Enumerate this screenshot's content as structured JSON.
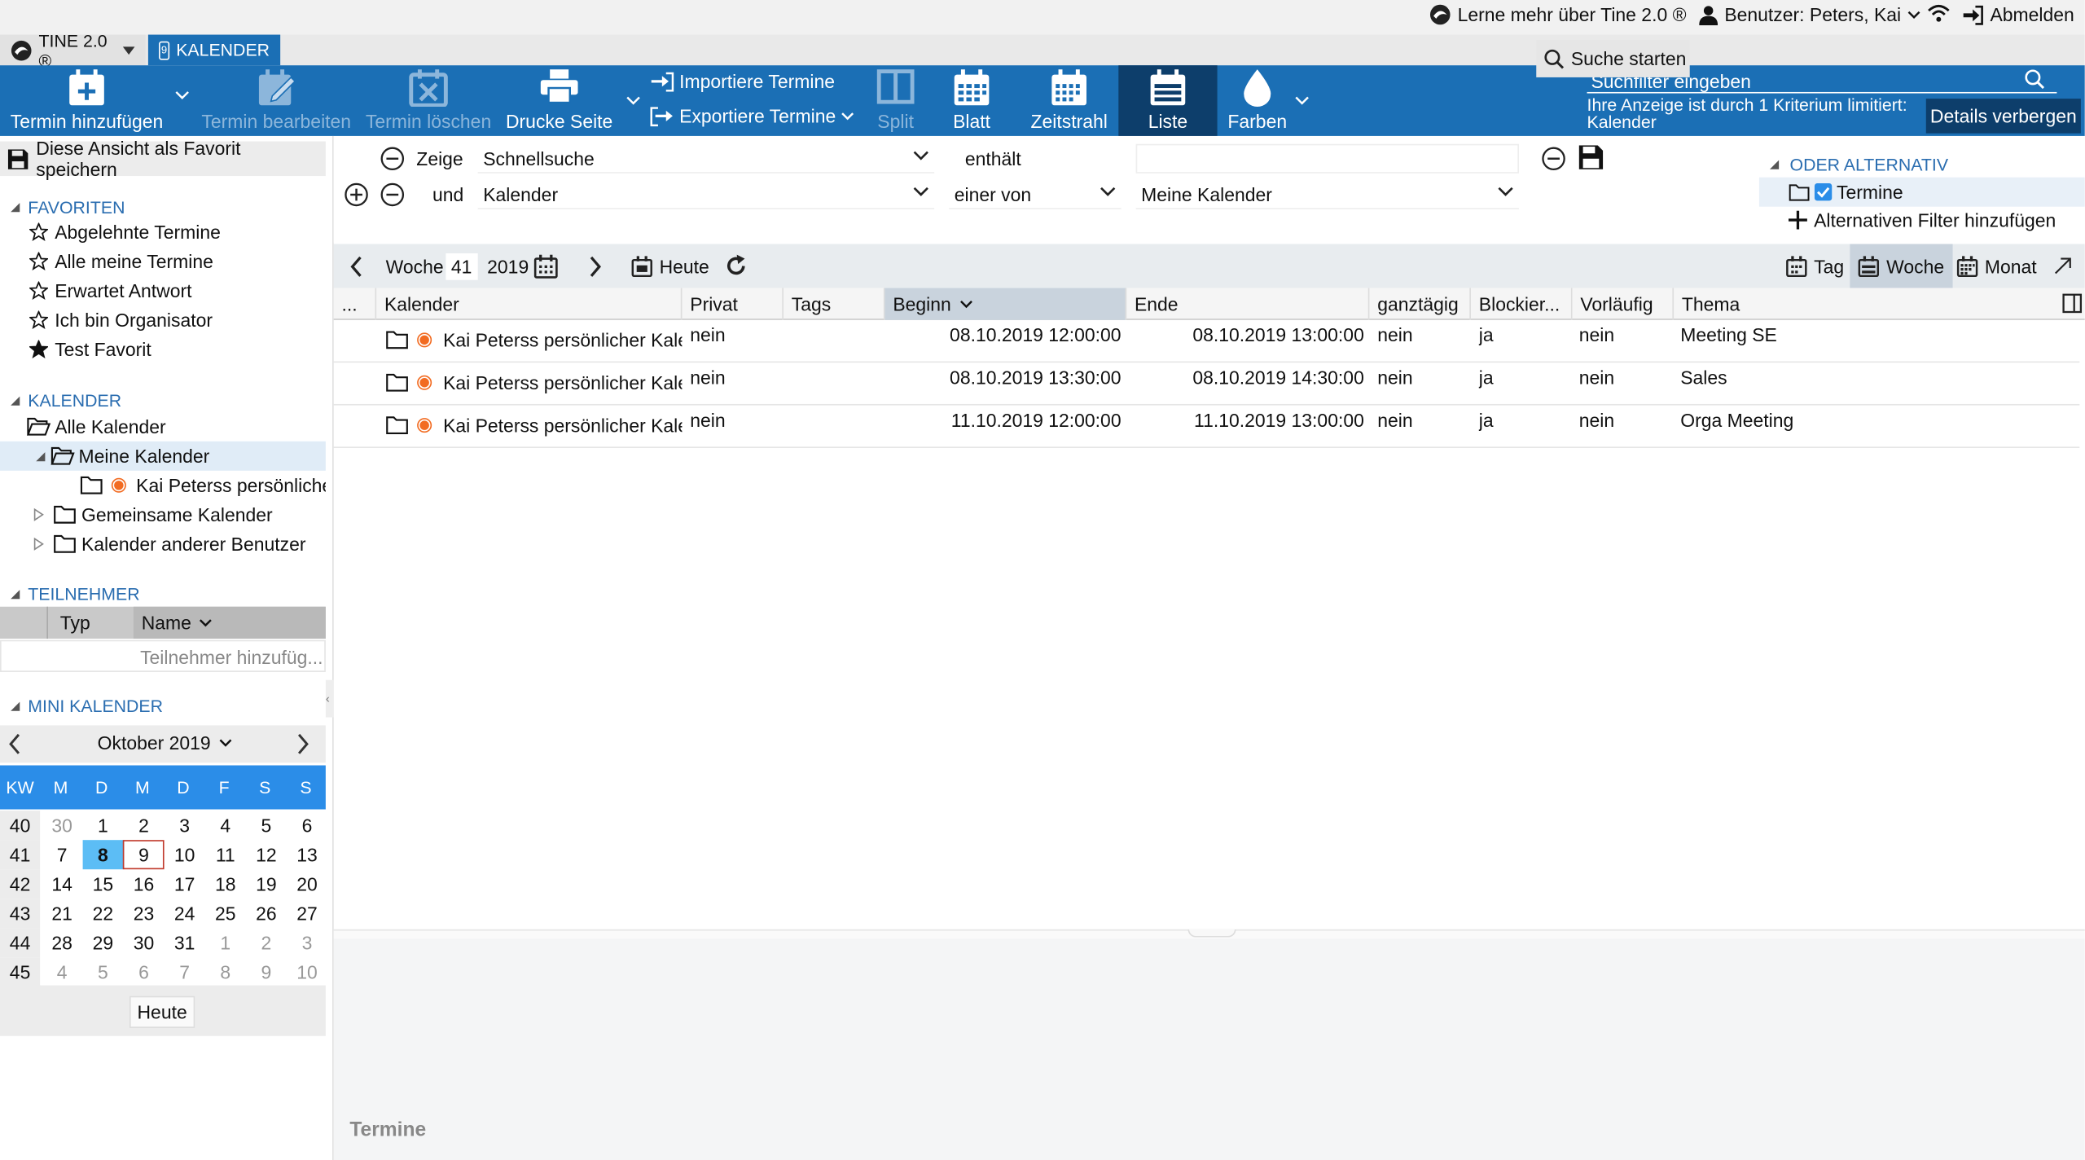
{
  "topbar": {
    "learn_more": "Lerne mehr über Tine 2.0 ®",
    "user": "Benutzer: Peters, Kai",
    "logout": "Abmelden"
  },
  "tabs": {
    "app": "TINE 2.0 ®",
    "calendar": "KALENDER",
    "calendar_icon_day": "9"
  },
  "toolbar": {
    "add": "Termin hinzufügen",
    "edit": "Termin bearbeiten",
    "delete": "Termin löschen",
    "print": "Drucke Seite",
    "import": "Importiere Termine",
    "export": "Exportiere Termine",
    "split": "Split",
    "sheet": "Blatt",
    "timeline": "Zeitstrahl",
    "list": "Liste",
    "colors": "Farben",
    "search_placeholder": "Suchfilter eingeben",
    "limit_text": "Ihre Anzeige ist durch 1 Kriterium limitiert: Kalender",
    "details_button": "Details verbergen"
  },
  "left": {
    "save_favorite": "Diese Ansicht als Favorit speichern",
    "favorites_title": "FAVORITEN",
    "favorites": [
      "Abgelehnte Termine",
      "Alle meine Termine",
      "Erwartet Antwort",
      "Ich bin Organisator",
      "Test Favorit"
    ],
    "calendar_title": "KALENDER",
    "all_calendars": "Alle Kalender",
    "my_calendars": "Meine Kalender",
    "personal_calendar": "Kai Peterss persönlicher Kalender",
    "shared_calendars": "Gemeinsame Kalender",
    "other_users": "Kalender anderer Benutzer",
    "participants_title": "TEILNEHMER",
    "participants_col_type": "Typ",
    "participants_col_name": "Name",
    "participants_add": "Teilnehmer hinzufüg...",
    "mini_title": "MINI KALENDER",
    "mini_month": "Oktober 2019",
    "mini_today": "Heute",
    "weekday_headers": [
      "KW",
      "M",
      "D",
      "M",
      "D",
      "F",
      "S",
      "S"
    ],
    "weeks": [
      {
        "kw": "40",
        "days": [
          "30",
          "1",
          "2",
          "3",
          "4",
          "5",
          "6"
        ],
        "out": [
          0
        ]
      },
      {
        "kw": "41",
        "days": [
          "7",
          "8",
          "9",
          "10",
          "11",
          "12",
          "13"
        ],
        "out": []
      },
      {
        "kw": "42",
        "days": [
          "14",
          "15",
          "16",
          "17",
          "18",
          "19",
          "20"
        ],
        "out": []
      },
      {
        "kw": "43",
        "days": [
          "21",
          "22",
          "23",
          "24",
          "25",
          "26",
          "27"
        ],
        "out": []
      },
      {
        "kw": "44",
        "days": [
          "28",
          "29",
          "30",
          "31",
          "1",
          "2",
          "3"
        ],
        "out": [
          4,
          5,
          6
        ]
      },
      {
        "kw": "45",
        "days": [
          "4",
          "5",
          "6",
          "7",
          "8",
          "9",
          "10"
        ],
        "out": [
          0,
          1,
          2,
          3,
          4,
          5,
          6
        ]
      }
    ]
  },
  "filter": {
    "show": "Zeige",
    "quicksearch": "Schnellsuche",
    "contains": "enthält",
    "and": "und",
    "calendar": "Kalender",
    "one_of": "einer von",
    "my_calendars": "Meine Kalender",
    "search_start": "Suche starten",
    "or_alt": "ODER ALTERNATIV",
    "alt_termine": "Termine",
    "add_alt": "Alternativen Filter hinzufügen"
  },
  "gridbar": {
    "week_label": "Woche",
    "week_number": "41",
    "year": "2019",
    "today": "Heute",
    "view_day": "Tag",
    "view_week": "Woche",
    "view_month": "Monat"
  },
  "grid": {
    "columns": [
      "...",
      "Kalender",
      "Privat",
      "Tags",
      "Beginn",
      "Ende",
      "ganztägig",
      "Blockier...",
      "Vorläufig",
      "Thema"
    ],
    "rows": [
      {
        "calendar": "Kai Peterss persönlicher Kalender",
        "private": "nein",
        "tags": "",
        "start": "08.10.2019 12:00:00",
        "end": "08.10.2019 13:00:00",
        "allday": "nein",
        "blocking": "ja",
        "tentative": "nein",
        "subject": "Meeting SE"
      },
      {
        "calendar": "Kai Peterss persönlicher Kalender",
        "private": "nein",
        "tags": "",
        "start": "08.10.2019 13:30:00",
        "end": "08.10.2019 14:30:00",
        "allday": "nein",
        "blocking": "ja",
        "tentative": "nein",
        "subject": "Sales"
      },
      {
        "calendar": "Kai Peterss persönlicher Kalender",
        "private": "nein",
        "tags": "",
        "start": "11.10.2019 12:00:00",
        "end": "11.10.2019 13:00:00",
        "allday": "nein",
        "blocking": "ja",
        "tentative": "nein",
        "subject": "Orga Meeting"
      }
    ]
  },
  "detail": {
    "title": "Termine"
  },
  "colors": {
    "brand": "#1b6fb5",
    "calendar_dot": "#f26b21",
    "today": "#5cbdf5"
  }
}
